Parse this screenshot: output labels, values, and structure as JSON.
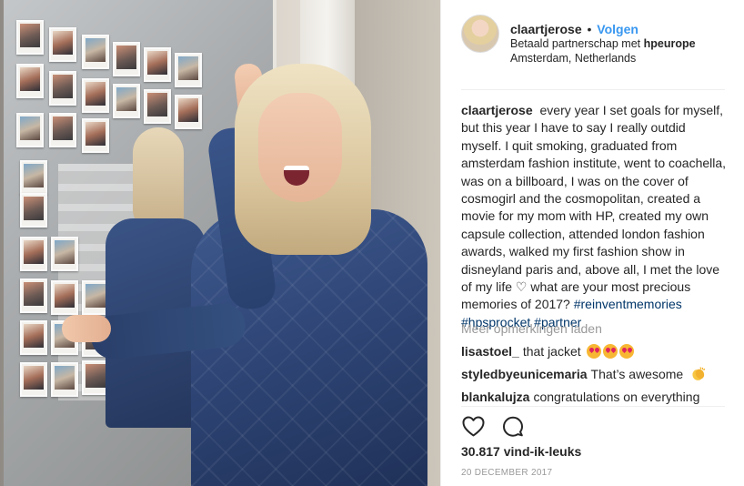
{
  "post": {
    "photo_alt": "",
    "header": {
      "username": "claartjerose",
      "separator": "•",
      "follow_label": "Volgen",
      "partnership_prefix": "Betaald partnerschap met",
      "partner": "hpeurope",
      "location": "Amsterdam, Netherlands"
    },
    "caption": {
      "username": "claartjerose",
      "text": "every year I set goals for myself, but this year I have to say I really outdid myself. I quit smoking, graduated from amsterdam fashion institute, went to coachella, was on a billboard, I was on the cover of cosmogirl and the cosmopolitan, created a movie for my mom with HP, created my own capsule collection, attended london fashion awards, walked my first fashion show in disneyland paris and, above all, I met the love of my life ♡ what are your most precious memories of 2017?",
      "hashtags": "#reinventmemories #hpsprocket #partner"
    },
    "load_more_label": "Meer opmerkingen laden",
    "comments": [
      {
        "username": "lisastoel_",
        "text": "that jacket",
        "emoji": "heart-eyes-x3"
      },
      {
        "username": "styledbyeunicemaria",
        "text": "That’s awesome",
        "emoji": "clapping-hands"
      },
      {
        "username": "blankalujza",
        "text": "congratulations on everything",
        "emoji": ""
      }
    ],
    "actions": {
      "like_icon": "heart-outline-icon",
      "comment_icon": "speech-bubble-icon"
    },
    "likes_label": "30.817 vind-ik-leuks",
    "date": "20 DECEMBER 2017"
  },
  "colors": {
    "link_blue": "#3897f0",
    "hashtag_blue": "#003569",
    "muted_gray": "#999999",
    "text": "#262626",
    "jacket_blue": "#2f4677"
  }
}
